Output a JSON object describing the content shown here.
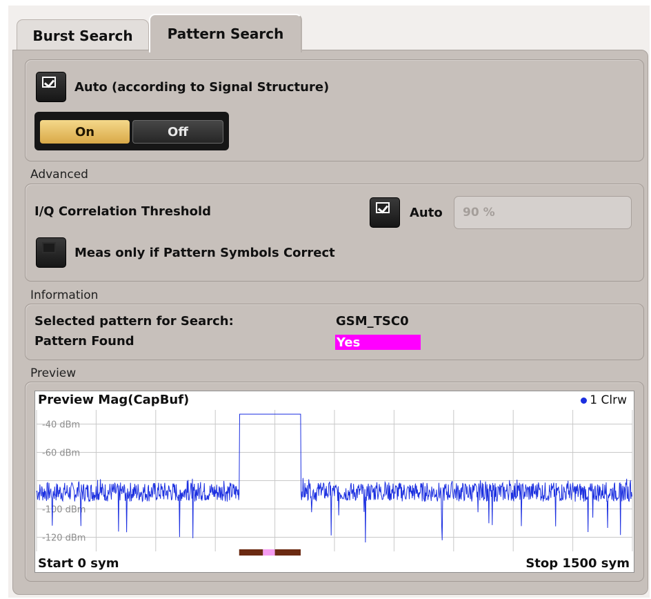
{
  "tabs": [
    {
      "label": "Burst Search",
      "active": false
    },
    {
      "label": "Pattern Search",
      "active": true
    }
  ],
  "auto_section": {
    "checkbox_label": "Auto (according to Signal Structure)",
    "checked": true,
    "toggle": {
      "on_label": "On",
      "off_label": "Off",
      "selected": "On"
    }
  },
  "advanced": {
    "section_label": "Advanced",
    "threshold_label": "I/Q Correlation Threshold",
    "auto_label": "Auto",
    "auto_checked": true,
    "threshold_value": "90 %",
    "meas_label": "Meas only if Pattern Symbols Correct",
    "meas_checked": false
  },
  "information": {
    "section_label": "Information",
    "selected_pattern_label": "Selected pattern for Search:",
    "selected_pattern_value": "GSM_TSC0",
    "pattern_found_label": "Pattern Found",
    "pattern_found_value": "Yes"
  },
  "preview": {
    "section_label": "Preview",
    "title": "Preview Mag(CapBuf)",
    "legend": "1 Clrw",
    "start_label": "Start 0 sym",
    "stop_label": "Stop 1500 sym"
  },
  "colors": {
    "trace": "#1b2fe0",
    "pattern_found": "#ff00ff",
    "toggle_on": "#e3b75a",
    "burst_marker": "#6b2a12",
    "pattern_marker": "#f49cf0"
  },
  "chart_data": {
    "type": "line",
    "x_range": [
      0,
      1500
    ],
    "y_range": [
      -130,
      -30
    ],
    "yticks": [
      {
        "value": -40,
        "label": "-40 dBm"
      },
      {
        "value": -60,
        "label": "-60 dBm"
      },
      {
        "value": -100,
        "label": "-100 dBm"
      },
      {
        "value": -120,
        "label": "-120 dBm"
      }
    ],
    "series": [
      {
        "noise_floor": -88,
        "burst_start": 510,
        "burst_end": 665,
        "burst_level": -33
      }
    ],
    "markers": [
      {
        "start": 510,
        "end": 570,
        "type": "burst"
      },
      {
        "start": 570,
        "end": 600,
        "type": "pattern"
      },
      {
        "start": 600,
        "end": 665,
        "type": "burst"
      }
    ]
  }
}
